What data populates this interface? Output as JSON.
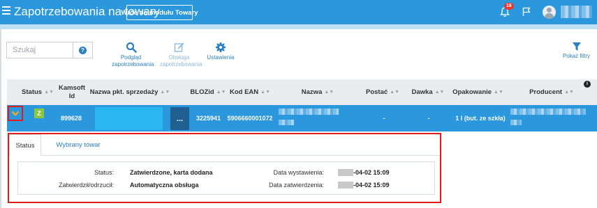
{
  "header": {
    "title": "Zapotrzebowania na towary",
    "back_button": "Wróć do modułu Towary",
    "notification_count": "16",
    "brand_color": "#2b97dd"
  },
  "toolbar": {
    "search_placeholder": "Szukaj",
    "help_label": "?",
    "preview_label_1": "Podgląd",
    "preview_label_2": "zapotrzebowania",
    "handle_label_1": "Obsługa",
    "handle_label_2": "zapotrzebowania",
    "settings_label": "Ustawienia",
    "filters_label": "Pokaż filtry"
  },
  "table": {
    "columns": {
      "status": "Status",
      "kamsoft_id_1": "Kamsoft",
      "kamsoft_id_2": "Id",
      "shop_name": "Nazwa pkt. sprzedaży",
      "blozid": "BLOZid",
      "ean": "Kod EAN",
      "name": "Nazwa",
      "form": "Postać",
      "dose": "Dawka",
      "package": "Opakowanie",
      "producer": "Producent"
    },
    "row": {
      "status_letter": "Z",
      "kamsoft_id": "899628",
      "more": "...",
      "blozid": "3225941",
      "ean": "5906660001072",
      "form": "-",
      "dose": "-",
      "package": "1 l (but. ze szkła)"
    }
  },
  "detail": {
    "tab_status": "Status",
    "tab_product": "Wybrany towar",
    "status_label": "Status:",
    "status_value": "Zatwierdzone, karta dodana",
    "approved_by_label": "Zatwierdził/odrzucił:",
    "approved_by_value": "Automatyczna obsługa",
    "issued_label": "Data wystawienia:",
    "issued_value": "-04-02 15:09",
    "approved_label": "Data zatwierdzenia:",
    "approved_value": "-04-02 15:09"
  }
}
